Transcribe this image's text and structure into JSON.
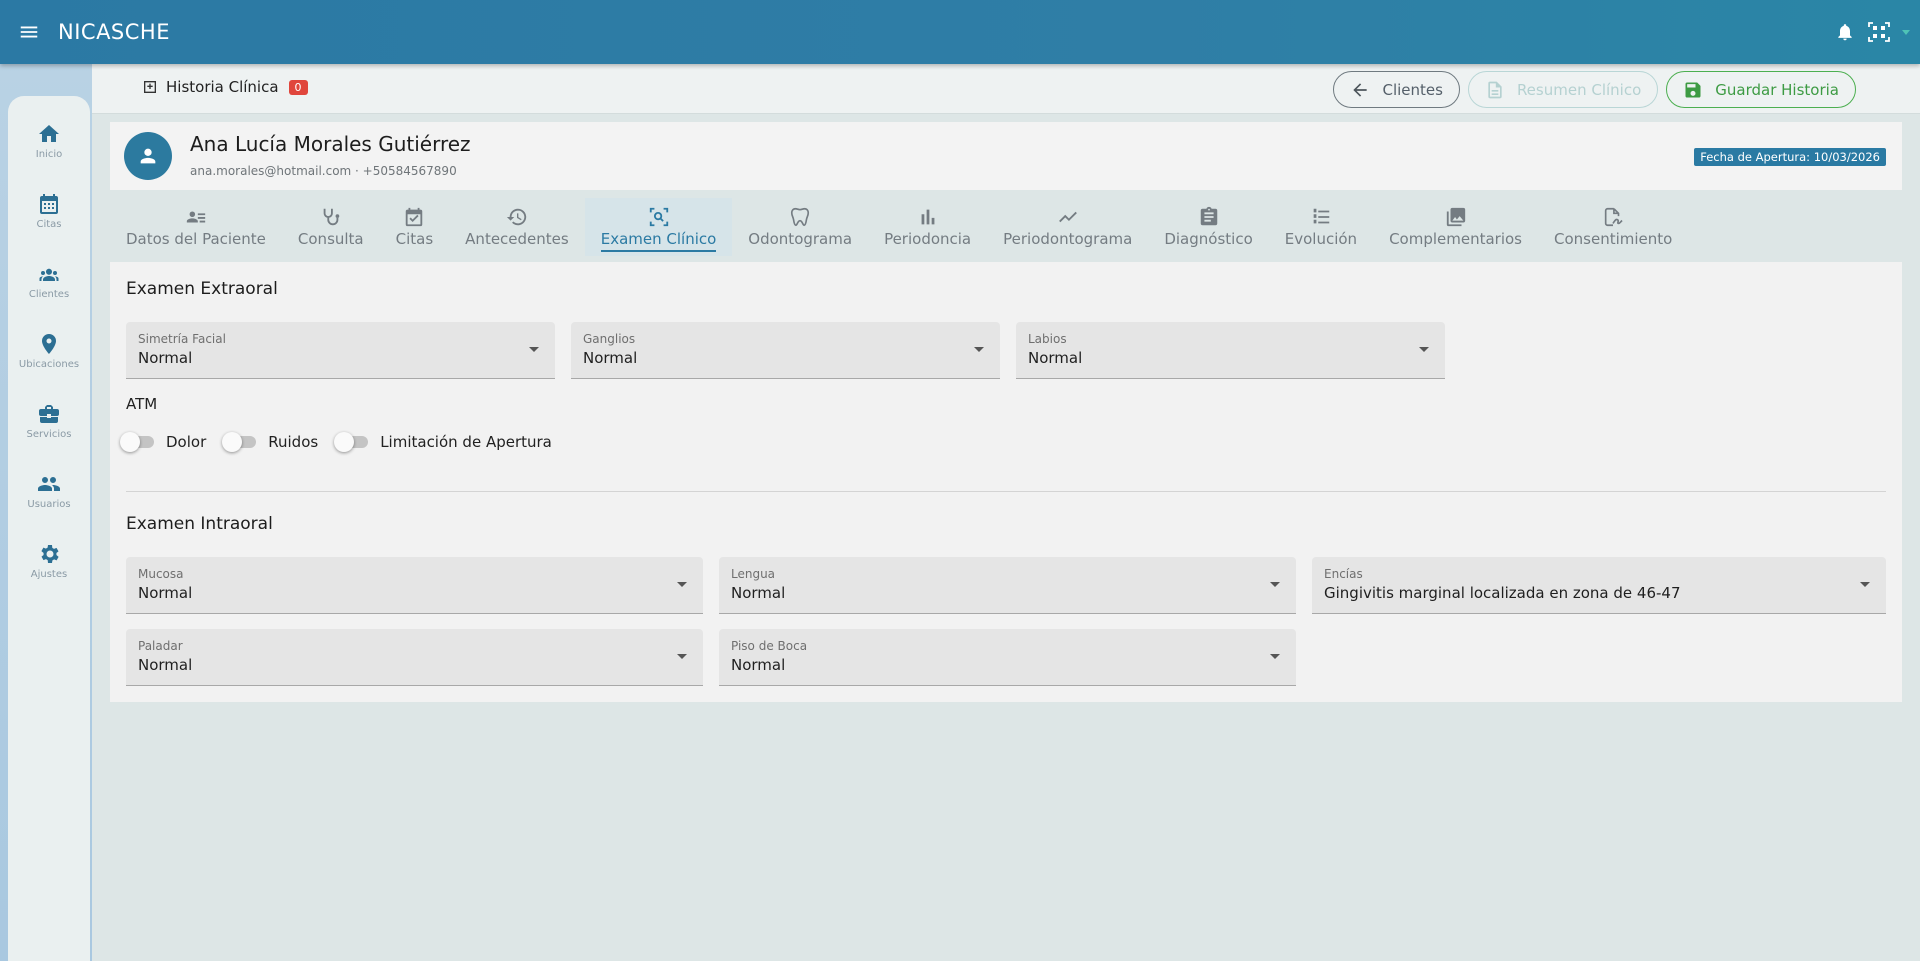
{
  "app": {
    "title": "NICASCHE"
  },
  "sidebar": {
    "items": [
      {
        "label": "Inicio",
        "icon": "home-icon"
      },
      {
        "label": "Citas",
        "icon": "calendar-icon"
      },
      {
        "label": "Clientes",
        "icon": "group-icon"
      },
      {
        "label": "Ubicaciones",
        "icon": "location-icon"
      },
      {
        "label": "Servicios",
        "icon": "briefcase-icon"
      },
      {
        "label": "Usuarios",
        "icon": "users-icon"
      },
      {
        "label": "Ajustes",
        "icon": "gear-icon"
      }
    ]
  },
  "header": {
    "section_title": "Historia Clínica",
    "badge_count": "0",
    "btn_back": "Clientes",
    "btn_summary": "Resumen Clínico",
    "btn_save": "Guardar Historia"
  },
  "patient": {
    "name": "Ana Lucía Morales Gutiérrez",
    "contact": "ana.morales@hotmail.com · +50584567890",
    "opening_date": "Fecha de Apertura: 10/03/2026"
  },
  "tabs": [
    {
      "label": "Datos del Paciente",
      "icon": "person-list-icon"
    },
    {
      "label": "Consulta",
      "icon": "stethoscope-icon"
    },
    {
      "label": "Citas",
      "icon": "calendar-check-icon"
    },
    {
      "label": "Antecedentes",
      "icon": "history-icon"
    },
    {
      "label": "Examen Clínico",
      "icon": "search-exam-icon",
      "active": true
    },
    {
      "label": "Odontograma",
      "icon": "tooth-icon"
    },
    {
      "label": "Periodoncia",
      "icon": "bar-chart-icon"
    },
    {
      "label": "Periodontograma",
      "icon": "line-chart-icon"
    },
    {
      "label": "Diagnóstico",
      "icon": "clipboard-icon"
    },
    {
      "label": "Evolución",
      "icon": "timeline-icon"
    },
    {
      "label": "Complementarios",
      "icon": "images-icon"
    },
    {
      "label": "Consentimiento",
      "icon": "signature-icon"
    }
  ],
  "extraoral": {
    "title": "Examen Extraoral",
    "fields": [
      {
        "label": "Simetría Facial",
        "value": "Normal"
      },
      {
        "label": "Ganglios",
        "value": "Normal"
      },
      {
        "label": "Labios",
        "value": "Normal"
      }
    ],
    "atm_title": "ATM",
    "switches": [
      {
        "label": "Dolor",
        "on": false
      },
      {
        "label": "Ruidos",
        "on": false
      },
      {
        "label": "Limitación de Apertura",
        "on": false
      }
    ]
  },
  "intraoral": {
    "title": "Examen Intraoral",
    "fields": [
      {
        "label": "Mucosa",
        "value": "Normal"
      },
      {
        "label": "Lengua",
        "value": "Normal"
      },
      {
        "label": "Encías",
        "value": "Gingivitis marginal localizada en zona de 46-47"
      },
      {
        "label": "Paladar",
        "value": "Normal"
      },
      {
        "label": "Piso de Boca",
        "value": "Normal"
      }
    ]
  },
  "colors": {
    "primary": "#2b79a4",
    "badge_red": "#e0463c",
    "save_green": "#4caf50"
  }
}
